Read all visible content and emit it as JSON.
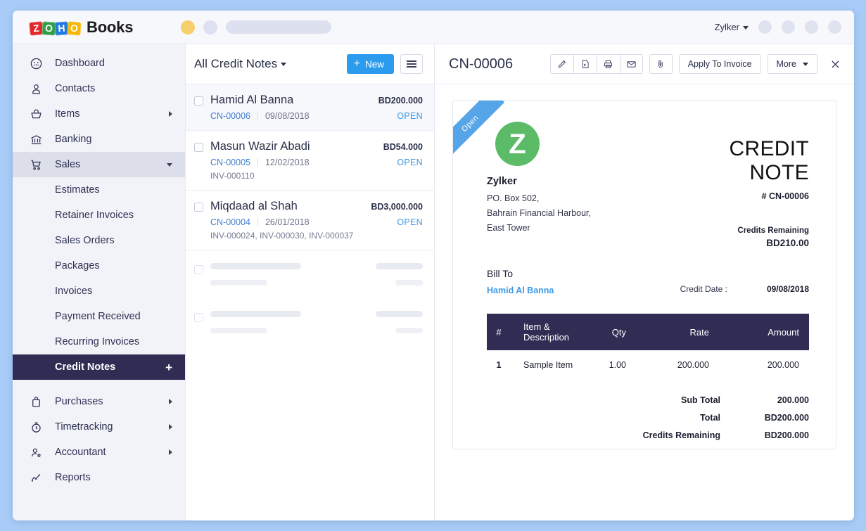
{
  "topbar": {
    "brand": "Books",
    "logo_letters": [
      "Z",
      "O",
      "H",
      "O"
    ],
    "org_name": "Zylker"
  },
  "sidebar": {
    "items": [
      {
        "label": "Dashboard",
        "icon": "dashboard-icon"
      },
      {
        "label": "Contacts",
        "icon": "contacts-icon"
      },
      {
        "label": "Items",
        "icon": "items-basket-icon",
        "chevron": "right"
      },
      {
        "label": "Banking",
        "icon": "bank-icon"
      },
      {
        "label": "Sales",
        "icon": "cart-icon",
        "chevron": "down",
        "state": "active-parent"
      }
    ],
    "sales_submenu": [
      {
        "label": "Estimates"
      },
      {
        "label": "Retainer Invoices"
      },
      {
        "label": "Sales Orders"
      },
      {
        "label": "Packages"
      },
      {
        "label": "Invoices"
      },
      {
        "label": "Payment Received"
      },
      {
        "label": "Recurring Invoices"
      },
      {
        "label": "Credit Notes",
        "state": "active",
        "add": "+"
      }
    ],
    "bottom_items": [
      {
        "label": "Purchases",
        "icon": "bag-icon",
        "chevron": "right"
      },
      {
        "label": "Timetracking",
        "icon": "stopwatch-icon",
        "chevron": "right"
      },
      {
        "label": "Accountant",
        "icon": "accountant-icon",
        "chevron": "right"
      },
      {
        "label": "Reports",
        "icon": "reports-icon"
      }
    ]
  },
  "list_panel": {
    "title": "All Credit Notes",
    "new_button": "New",
    "rows": [
      {
        "name": "Hamid Al Banna",
        "amount": "BD200.000",
        "number": "CN-00006",
        "date": "09/08/2018",
        "status": "OPEN",
        "invoices": ""
      },
      {
        "name": "Masun Wazir Abadi",
        "amount": "BD54.000",
        "number": "CN-00005",
        "date": "12/02/2018",
        "status": "OPEN",
        "invoices": "INV-000110"
      },
      {
        "name": "Miqdaad al Shah",
        "amount": "BD3,000.000",
        "number": "CN-00004",
        "date": "26/01/2018",
        "status": "OPEN",
        "invoices": "INV-000024, INV-000030, INV-000037"
      }
    ]
  },
  "detail": {
    "title": "CN-00006",
    "toolbar": {
      "edit": "edit-pencil-icon",
      "pdf": "pdf-file-icon",
      "print": "printer-icon",
      "email": "envelope-icon",
      "attach": "paperclip-icon",
      "apply_to_invoice": "Apply To Invoice",
      "more": "More",
      "close": "close-x-icon"
    },
    "document": {
      "ribbon": "Open",
      "logo_letter": "Z",
      "org_name": "Zylker",
      "org_address": [
        "PO. Box 502,",
        "Bahrain Financial Harbour,",
        "East Tower"
      ],
      "heading": "CREDIT NOTE",
      "number": "# CN-00006",
      "credits_remaining_label": "Credits Remaining",
      "credits_remaining_value": "BD210.00",
      "bill_to_label": "Bill To",
      "bill_to_name": "Hamid Al Banna",
      "credit_date_label": "Credit Date :",
      "credit_date_value": "09/08/2018",
      "table": {
        "headers": [
          "#",
          "Item & Description",
          "Qty",
          "Rate",
          "Amount"
        ],
        "rows": [
          {
            "idx": "1",
            "desc": "Sample Item",
            "qty": "1.00",
            "rate": "200.000",
            "amount": "200.000"
          }
        ]
      },
      "totals": [
        {
          "label": "Sub Total",
          "value": "200.000"
        },
        {
          "label": "Total",
          "value": "BD200.000"
        },
        {
          "label": "Credits Remaining",
          "value": "BD200.000"
        }
      ]
    }
  },
  "colors": {
    "accent_blue": "#2b9ced",
    "dark_navy": "#302c54",
    "status_open": "#3d9ae8",
    "logo_green": "#5cbb67",
    "page_bg": "#a8ccf7"
  }
}
